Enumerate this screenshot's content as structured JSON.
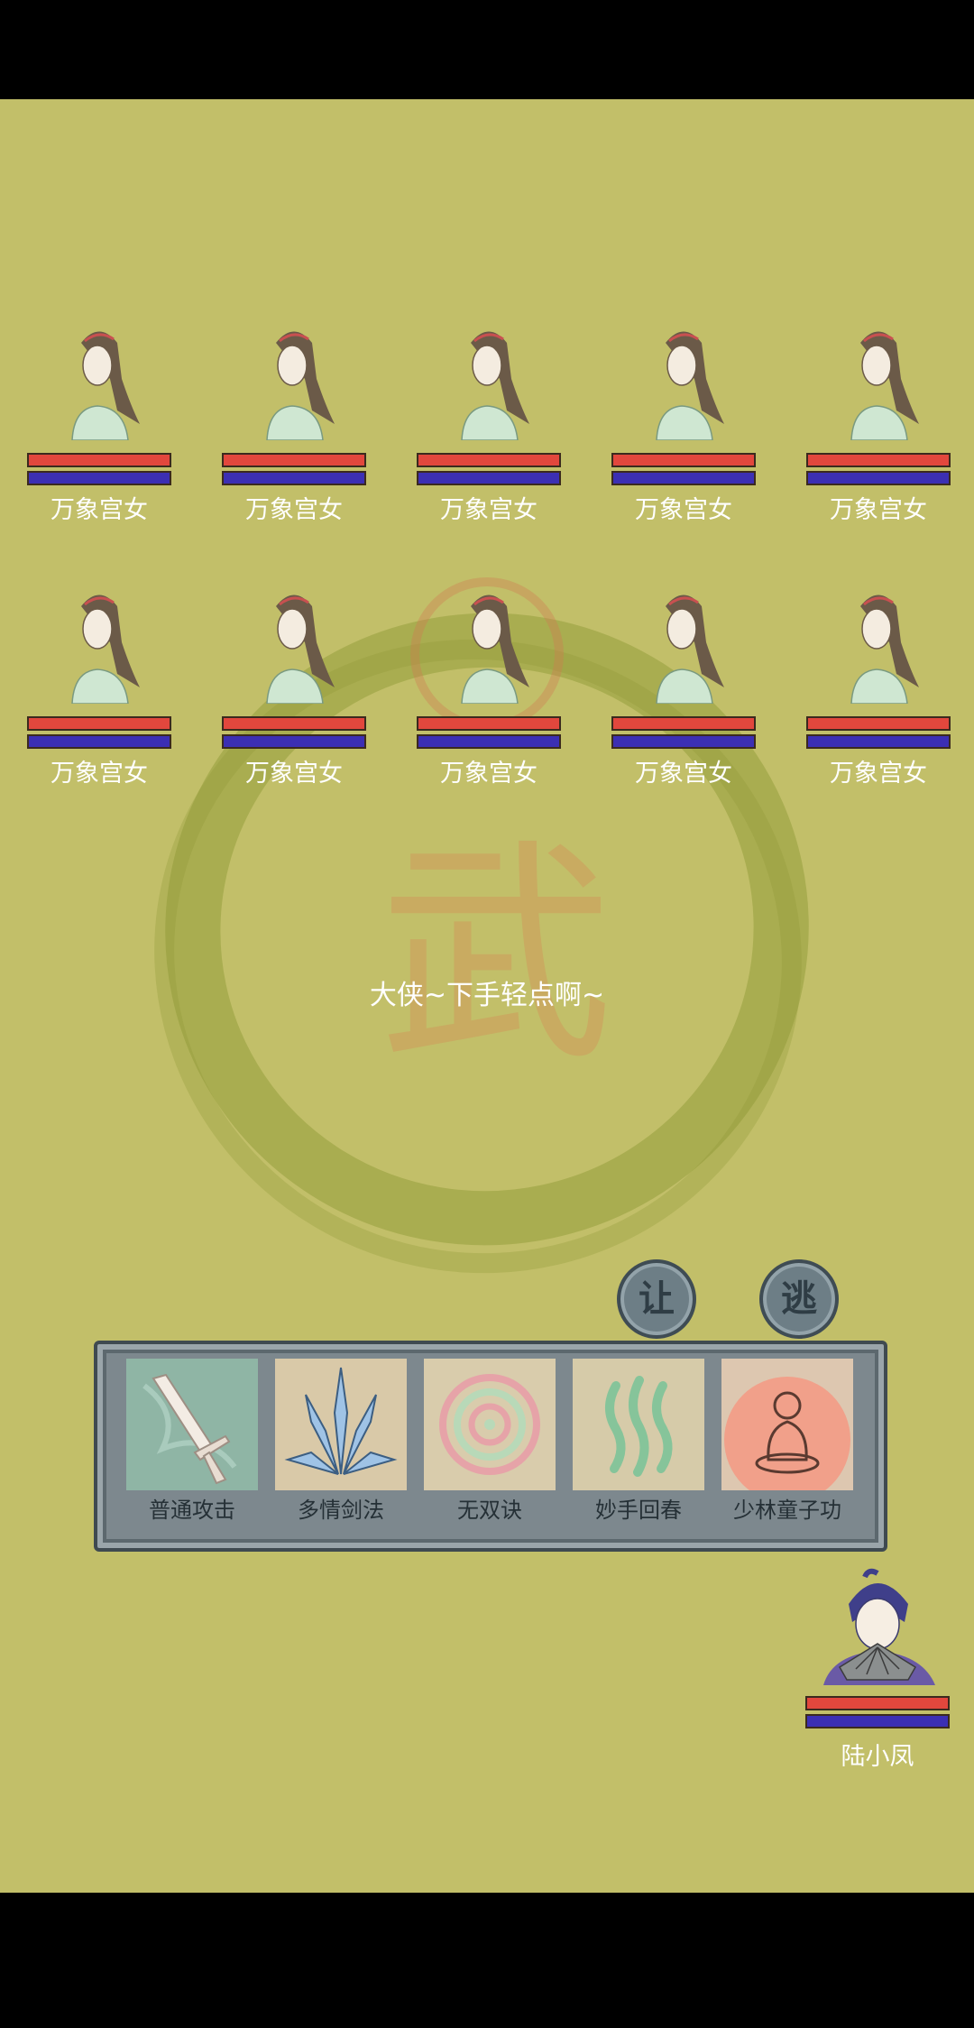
{
  "enemies": [
    {
      "name": "万象宫女",
      "hp": 1.0,
      "mp": 1.0
    },
    {
      "name": "万象宫女",
      "hp": 1.0,
      "mp": 1.0
    },
    {
      "name": "万象宫女",
      "hp": 1.0,
      "mp": 1.0
    },
    {
      "name": "万象宫女",
      "hp": 1.0,
      "mp": 1.0
    },
    {
      "name": "万象宫女",
      "hp": 1.0,
      "mp": 1.0
    },
    {
      "name": "万象宫女",
      "hp": 1.0,
      "mp": 1.0
    },
    {
      "name": "万象宫女",
      "hp": 1.0,
      "mp": 1.0
    },
    {
      "name": "万象宫女",
      "hp": 1.0,
      "mp": 1.0
    },
    {
      "name": "万象宫女",
      "hp": 1.0,
      "mp": 1.0
    },
    {
      "name": "万象宫女",
      "hp": 1.0,
      "mp": 1.0
    }
  ],
  "speech": "大侠~下手轻点啊~",
  "actions": {
    "yield_label": "让",
    "flee_label": "逃"
  },
  "skills": [
    {
      "label": "普通攻击",
      "icon": "sword-icon"
    },
    {
      "label": "多情剑法",
      "icon": "blades-icon"
    },
    {
      "label": "无双诀",
      "icon": "spiral-icon"
    },
    {
      "label": "妙手回春",
      "icon": "waves-icon"
    },
    {
      "label": "少林童子功",
      "icon": "meditating-monk-icon"
    }
  ],
  "player": {
    "name": "陆小凤",
    "hp": 1.0,
    "mp": 1.0
  },
  "colors": {
    "background": "#c2bf69",
    "hp_bar": "#e2473d",
    "mp_bar": "#3c2fb3",
    "panel": "#7d888e"
  }
}
